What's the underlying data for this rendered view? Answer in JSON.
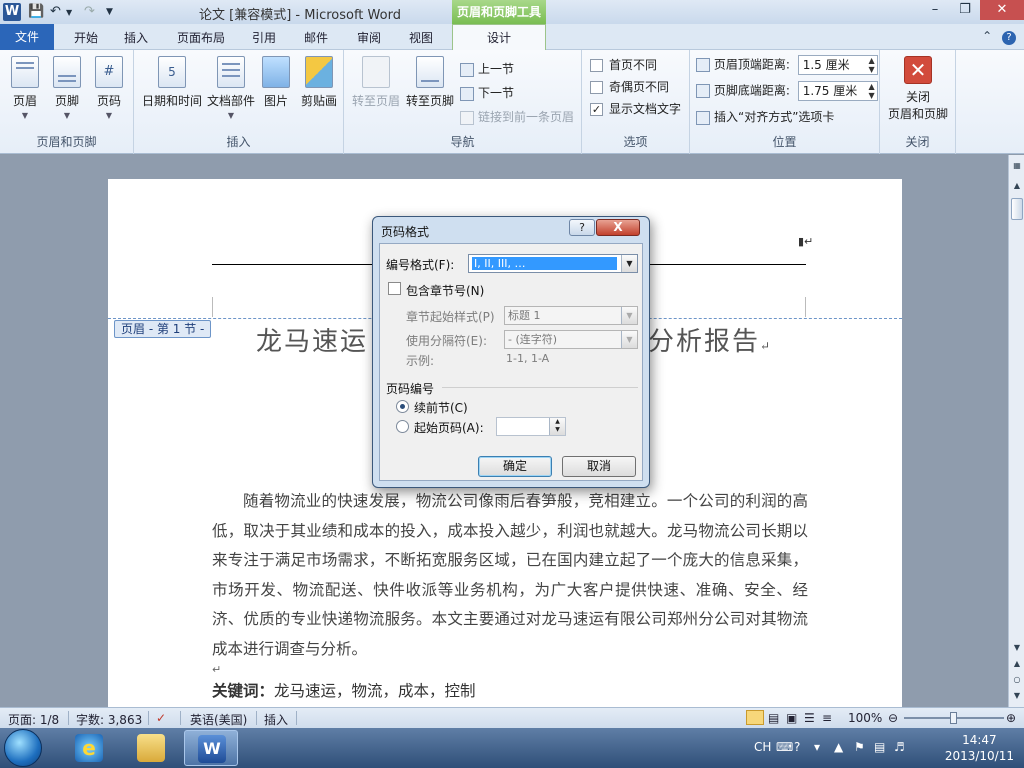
{
  "titlebar": {
    "app_icon": "W",
    "title": "论文 [兼容模式]  -  Microsoft Word",
    "context_title": "页眉和页脚工具"
  },
  "tabs": {
    "file": "文件",
    "home": "开始",
    "insert": "插入",
    "layout": "页面布局",
    "references": "引用",
    "mailings": "邮件",
    "review": "审阅",
    "view": "视图",
    "design": "设计"
  },
  "ribbon": {
    "hf_group": {
      "label": "页眉和页脚",
      "header": "页眉",
      "footer": "页脚",
      "page_number": "页码"
    },
    "insert_group": {
      "label": "插入",
      "datetime": "日期和时间",
      "quickparts": "文档部件",
      "picture": "图片",
      "clipart": "剪贴画"
    },
    "nav_group": {
      "label": "导航",
      "goto_header": "转至页眉",
      "goto_footer": "转至页脚",
      "previous": "上一节",
      "next": "下一节",
      "link_previous": "链接到前一条页眉"
    },
    "options_group": {
      "label": "选项",
      "different_first": "首页不同",
      "different_odd_even": "奇偶页不同",
      "show_doc_text": "显示文档文字",
      "show_doc_text_checked": true
    },
    "position_group": {
      "label": "位置",
      "header_top_label": "页眉顶端距离:",
      "header_top_value": "1.5 厘米",
      "footer_bottom_label": "页脚底端距离:",
      "footer_bottom_value": "1.75 厘米",
      "align_tab": "插入“对齐方式”选项卡"
    },
    "close_group": {
      "label": "关闭",
      "close_line1": "关闭",
      "close_line2": "页眉和页脚"
    }
  },
  "document": {
    "header_tag": "页眉 - 第 1 节 -",
    "title_left": "龙马速运",
    "title_right": "分析报告",
    "paragraph": "随着物流业的快速发展，物流公司像雨后春笋般，竞相建立。一个公司的利润的高低，取决于其业绩和成本的投入，成本投入越少，利润也就越大。龙马物流公司长期以来专注于满足市场需求，不断拓宽服务区域，已在国内建立起了一个庞大的信息采集，市场开发、物流配送、快件收派等业务机构，为广大客户提供快速、准确、安全、经济、优质的专业快递物流服务。本文主要通过对龙马速运有限公司郑州分公司对其物流成本进行调查与分析。",
    "keywords_label": "关键词：",
    "keywords": "龙马速运，物流，成本，控制"
  },
  "dialog": {
    "title": "页码格式",
    "help": "?",
    "close": "X",
    "number_format_label": "编号格式(F):",
    "number_format_value": "I, II, III, …",
    "include_chapter_label": "包含章节号(N)",
    "chapter_style_label": "章节起始样式(P)",
    "chapter_style_value": "标题 1",
    "separator_label": "使用分隔符(E):",
    "separator_value": "-  (连字符)",
    "example_label": "示例:",
    "example_value": "1-1, 1-A",
    "numbering_group": "页码编号",
    "continue_label": "续前节(C)",
    "start_at_label": "起始页码(A):",
    "start_at_value": "",
    "selected_numbering": "continue",
    "ok": "确定",
    "cancel": "取消"
  },
  "statusbar": {
    "page": "页面: 1/8",
    "words": "字数: 3,863",
    "language": "英语(美国)",
    "mode": "插入",
    "zoom": "100%",
    "zoom_fraction": 0.5
  },
  "taskbar": {
    "ime": "CH",
    "time": "14:47",
    "date": "2013/10/11"
  }
}
